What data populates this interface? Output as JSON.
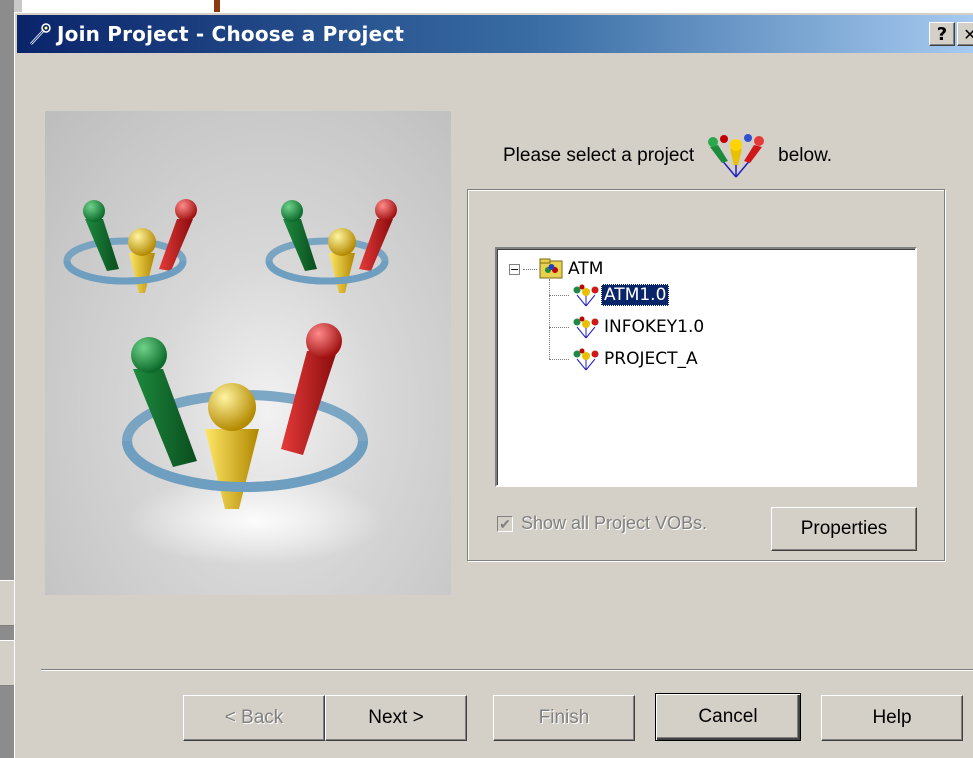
{
  "window": {
    "title": "Join Project - Choose a Project",
    "help_glyph": "?",
    "close_glyph": "✕"
  },
  "prompt": {
    "before": "Please select a project",
    "after": "below."
  },
  "tree": {
    "root": {
      "label": "ATM",
      "expander": "−"
    },
    "items": [
      {
        "label": "ATM1.0",
        "selected": true
      },
      {
        "label": "INFOKEY1.0",
        "selected": false
      },
      {
        "label": "PROJECT_A",
        "selected": false
      }
    ]
  },
  "options": {
    "show_all_vobs_label": "Show all Project VOBs.",
    "show_all_vobs_checked": true,
    "check_glyph": "✔",
    "properties_label": "Properties"
  },
  "buttons": {
    "back": "< Back",
    "next": "Next >",
    "finish": "Finish",
    "cancel": "Cancel",
    "help": "Help"
  },
  "colors": {
    "titlebar_start": "#0a246a",
    "titlebar_end": "#a6caf0",
    "selection": "#0a246a",
    "dialog_face": "#d4d0c8"
  }
}
